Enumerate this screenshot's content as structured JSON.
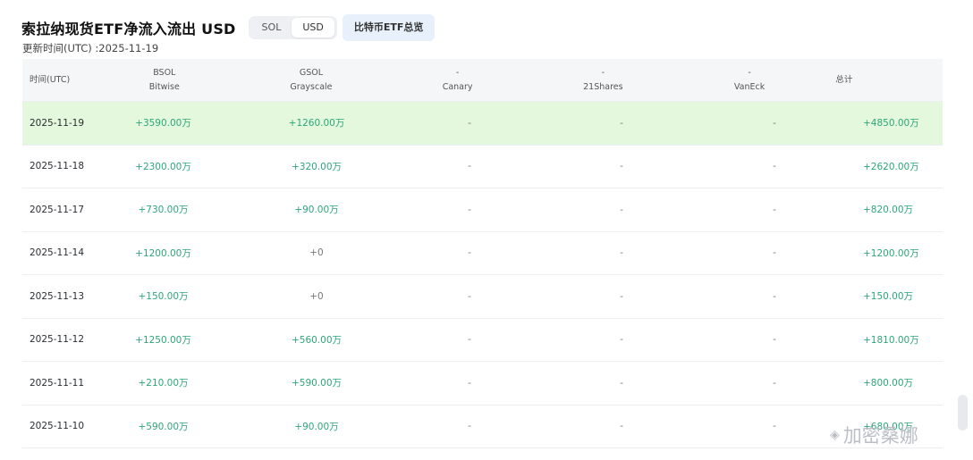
{
  "header": {
    "title": "索拉纳现货ETF净流入流出 USD",
    "toggle": [
      "SOL",
      "USD"
    ],
    "active_toggle": "USD",
    "overview_button": "比特币ETF总览"
  },
  "updated_label": "更新时间(UTC) :2025-11-19",
  "table": {
    "columns": [
      {
        "top": "",
        "bottom": "时间(UTC)"
      },
      {
        "top": "BSOL",
        "bottom": "Bitwise"
      },
      {
        "top": "GSOL",
        "bottom": "Grayscale"
      },
      {
        "top": "-",
        "bottom": "Canary"
      },
      {
        "top": "-",
        "bottom": "21Shares"
      },
      {
        "top": "-",
        "bottom": "VanEck"
      },
      {
        "top": "",
        "bottom": "总计"
      }
    ],
    "rows": [
      {
        "date": "2025-11-19",
        "bsol": "+3590.00万",
        "gsol": "+1260.00万",
        "canary": "-",
        "shares21": "-",
        "vaneck": "-",
        "total": "+4850.00万",
        "highlight": true
      },
      {
        "date": "2025-11-18",
        "bsol": "+2300.00万",
        "gsol": "+320.00万",
        "canary": "-",
        "shares21": "-",
        "vaneck": "-",
        "total": "+2620.00万",
        "highlight": false
      },
      {
        "date": "2025-11-17",
        "bsol": "+730.00万",
        "gsol": "+90.00万",
        "canary": "-",
        "shares21": "-",
        "vaneck": "-",
        "total": "+820.00万",
        "highlight": false
      },
      {
        "date": "2025-11-14",
        "bsol": "+1200.00万",
        "gsol": "+0",
        "canary": "-",
        "shares21": "-",
        "vaneck": "-",
        "total": "+1200.00万",
        "highlight": false
      },
      {
        "date": "2025-11-13",
        "bsol": "+150.00万",
        "gsol": "+0",
        "canary": "-",
        "shares21": "-",
        "vaneck": "-",
        "total": "+150.00万",
        "highlight": false
      },
      {
        "date": "2025-11-12",
        "bsol": "+1250.00万",
        "gsol": "+560.00万",
        "canary": "-",
        "shares21": "-",
        "vaneck": "-",
        "total": "+1810.00万",
        "highlight": false
      },
      {
        "date": "2025-11-11",
        "bsol": "+210.00万",
        "gsol": "+590.00万",
        "canary": "-",
        "shares21": "-",
        "vaneck": "-",
        "total": "+800.00万",
        "highlight": false
      },
      {
        "date": "2025-11-10",
        "bsol": "+590.00万",
        "gsol": "+90.00万",
        "canary": "-",
        "shares21": "-",
        "vaneck": "-",
        "total": "+680.00万",
        "highlight": false
      }
    ]
  },
  "watermark": "加密桑娜",
  "colors": {
    "positive": "#2ea67a",
    "highlight_row": "#e3f8dc"
  }
}
